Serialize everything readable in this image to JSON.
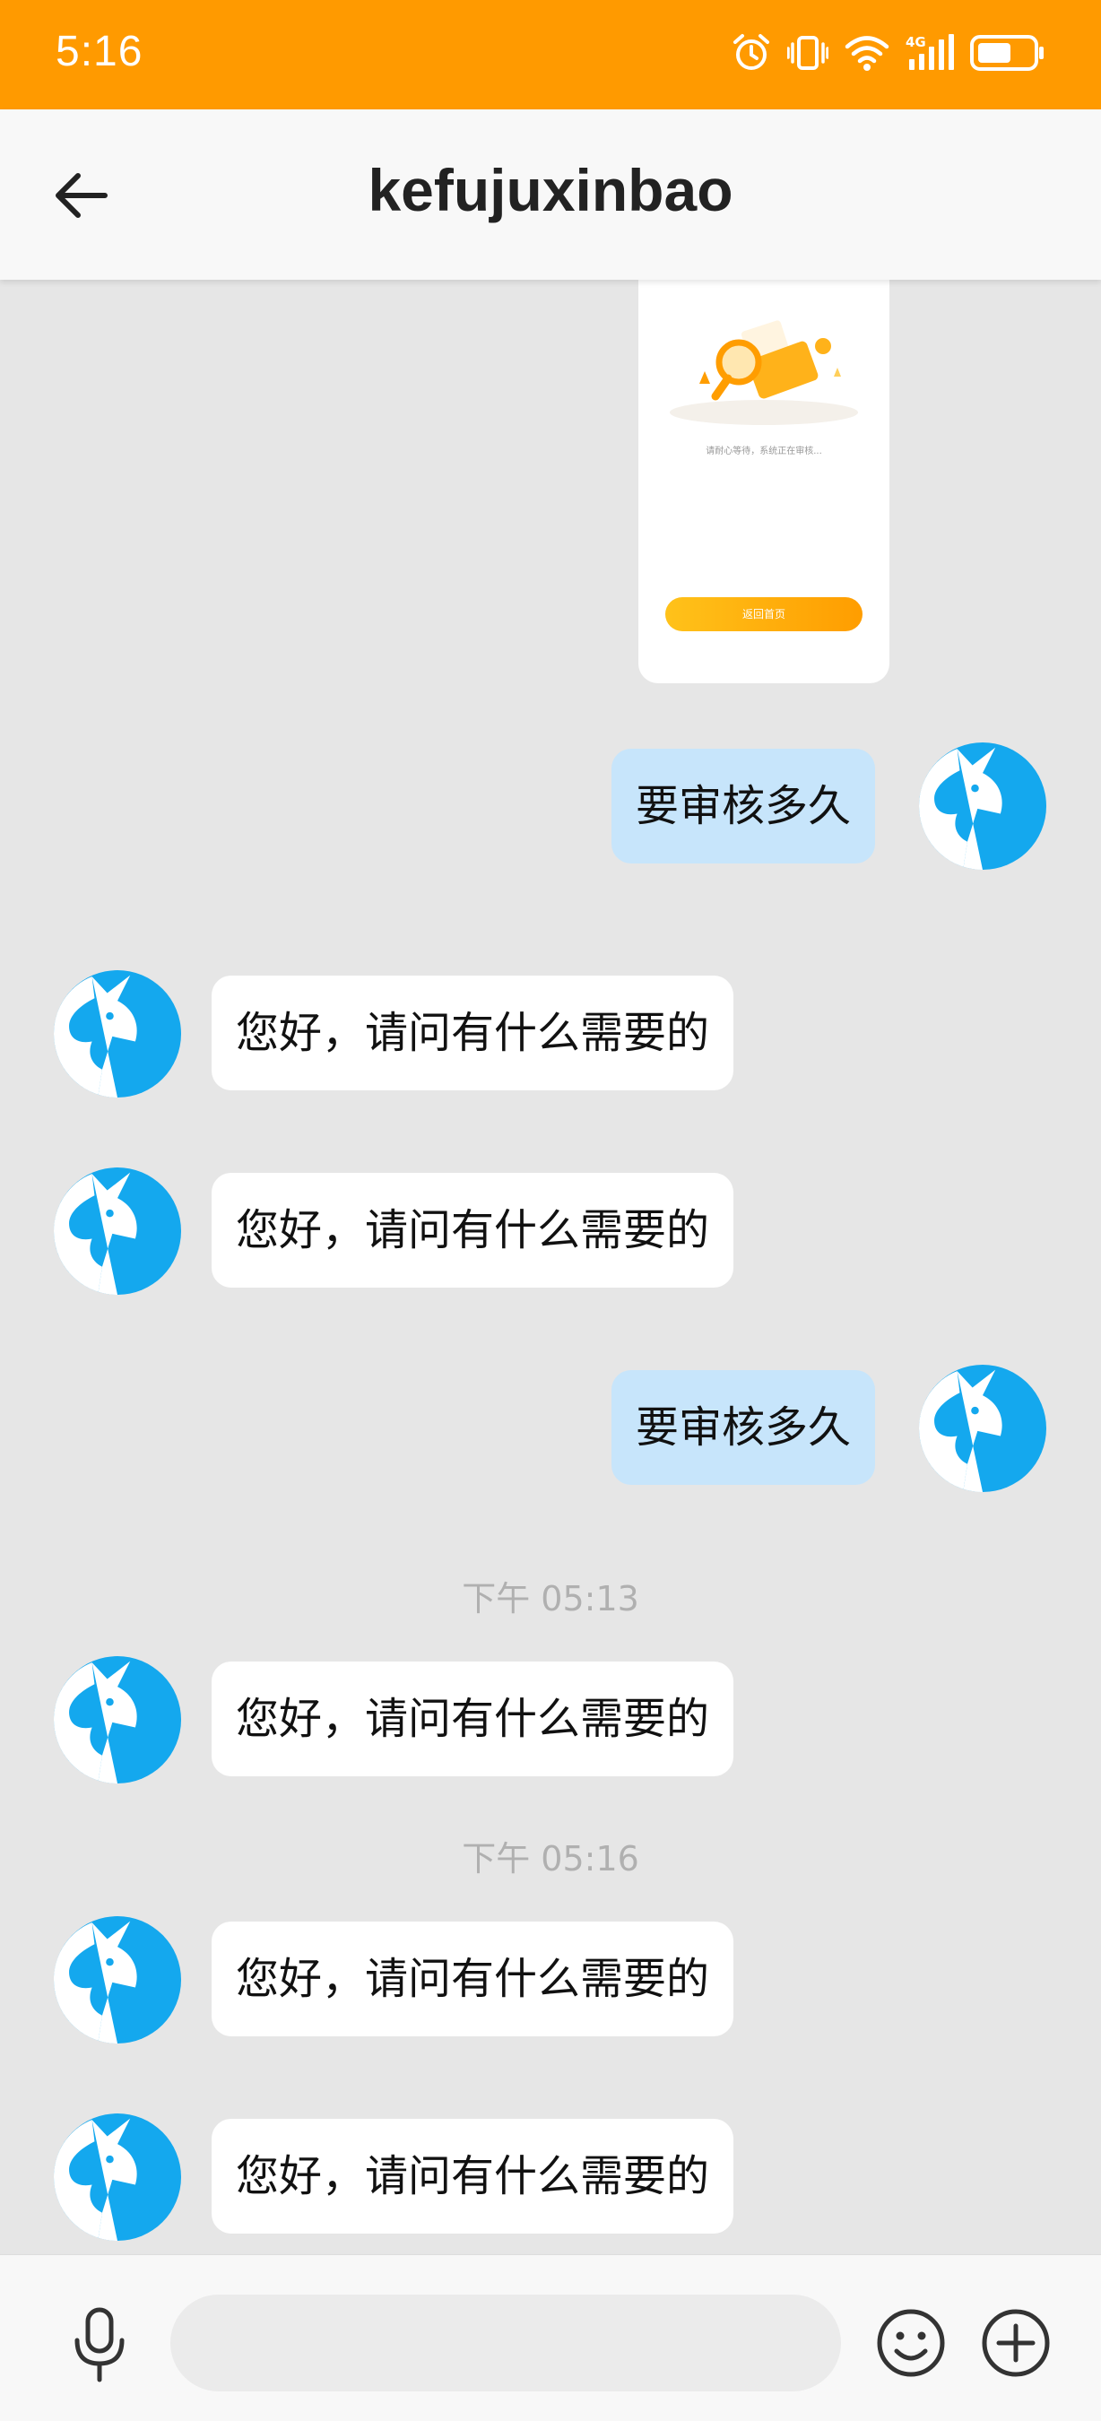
{
  "status_bar": {
    "time": "5:16",
    "network_label": "4G",
    "icons": [
      "alarm-icon",
      "vibrate-icon",
      "wifi-icon",
      "signal-icon",
      "battery-icon"
    ],
    "background_color": "#ff9a00"
  },
  "header": {
    "title": "kefujuxinbao",
    "back_icon": "back-arrow-icon"
  },
  "image_message": {
    "caption": "请耐心等待，系统正在审核...",
    "button_label": "返回首页"
  },
  "messages": [
    {
      "direction": "out",
      "text": "要审核多久"
    },
    {
      "direction": "in",
      "text": "您好，请问有什么需要的"
    },
    {
      "direction": "in",
      "text": "您好，请问有什么需要的"
    },
    {
      "direction": "out",
      "text": "要审核多久"
    },
    {
      "type": "timestamp",
      "text": "下午 05:13"
    },
    {
      "direction": "in",
      "text": "您好，请问有什么需要的"
    },
    {
      "type": "timestamp",
      "text": "下午 05:16"
    },
    {
      "direction": "in",
      "text": "您好，请问有什么需要的"
    },
    {
      "direction": "in",
      "text": "您好，请问有什么需要的"
    }
  ],
  "input_bar": {
    "placeholder": "",
    "icons": [
      "microphone-icon",
      "emoji-icon",
      "plus-icon"
    ]
  },
  "colors": {
    "accent": "#ff9a00",
    "incoming_bubble": "#ffffff",
    "outgoing_bubble": "#c7e5fb",
    "avatar_blue": "#14a8ee",
    "chat_background": "#e6e6e6"
  }
}
